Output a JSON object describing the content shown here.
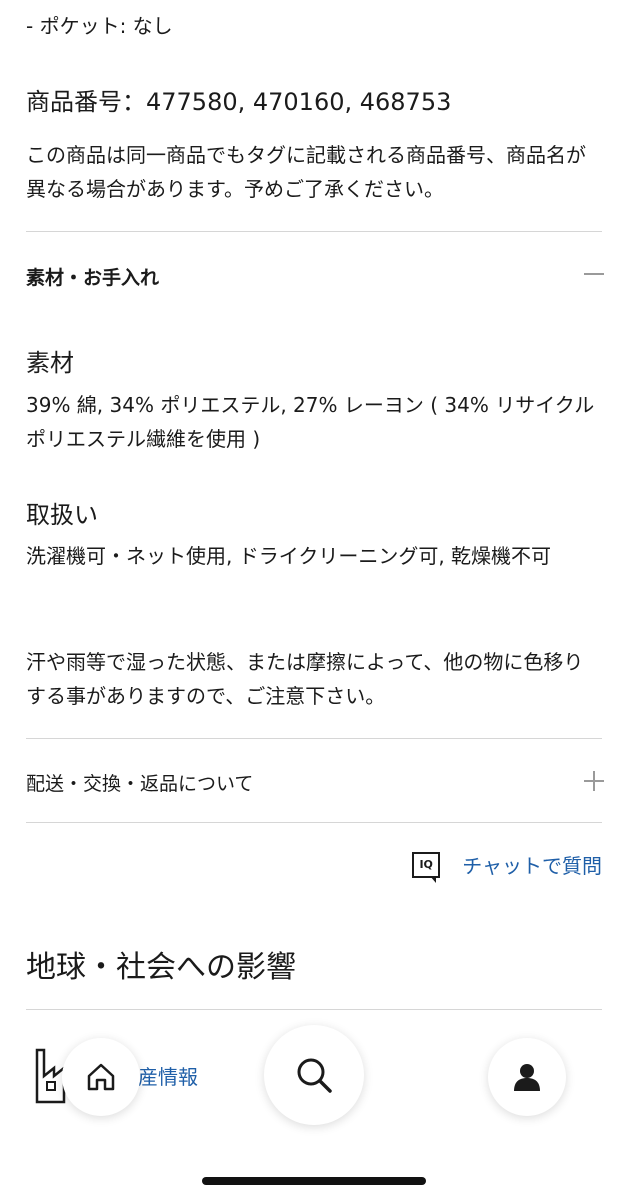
{
  "spec": {
    "pocket": "- ポケット: なし",
    "product_number": "商品番号：477580, 470160, 468753",
    "note": "この商品は同一商品でもタグに記載される商品番号、商品名が異なる場合があります。予めご了承ください。"
  },
  "materials_section": {
    "title": "素材・お手入れ",
    "toggle_icon": "minus-icon",
    "material_heading": "素材",
    "material_text": "39% 綿, 34% ポリエステル, 27% レーヨン ( 34% リサイクルポリエステル繊維を使用 )",
    "care_heading": "取扱い",
    "care_text": "洗濯機可・ネット使用, ドライクリーニング可, 乾燥機不可",
    "care_note": "汗や雨等で湿った状態、または摩擦によって、他の物に色移りする事がありますので、ご注意下さい。"
  },
  "shipping_section": {
    "title": "配送・交換・返品について",
    "toggle_icon": "plus-icon"
  },
  "chat": {
    "icon_label": "IQ",
    "label": "チャットで質問"
  },
  "impact": {
    "title": "地球・社会への影響",
    "partial_label": "産情報"
  },
  "bottom_nav": {
    "items": [
      "home-icon",
      "search-icon",
      "account-icon"
    ]
  },
  "colors": {
    "link": "#1f5fa8",
    "divider": "#d6d6d6",
    "text": "#1b1b1b"
  }
}
